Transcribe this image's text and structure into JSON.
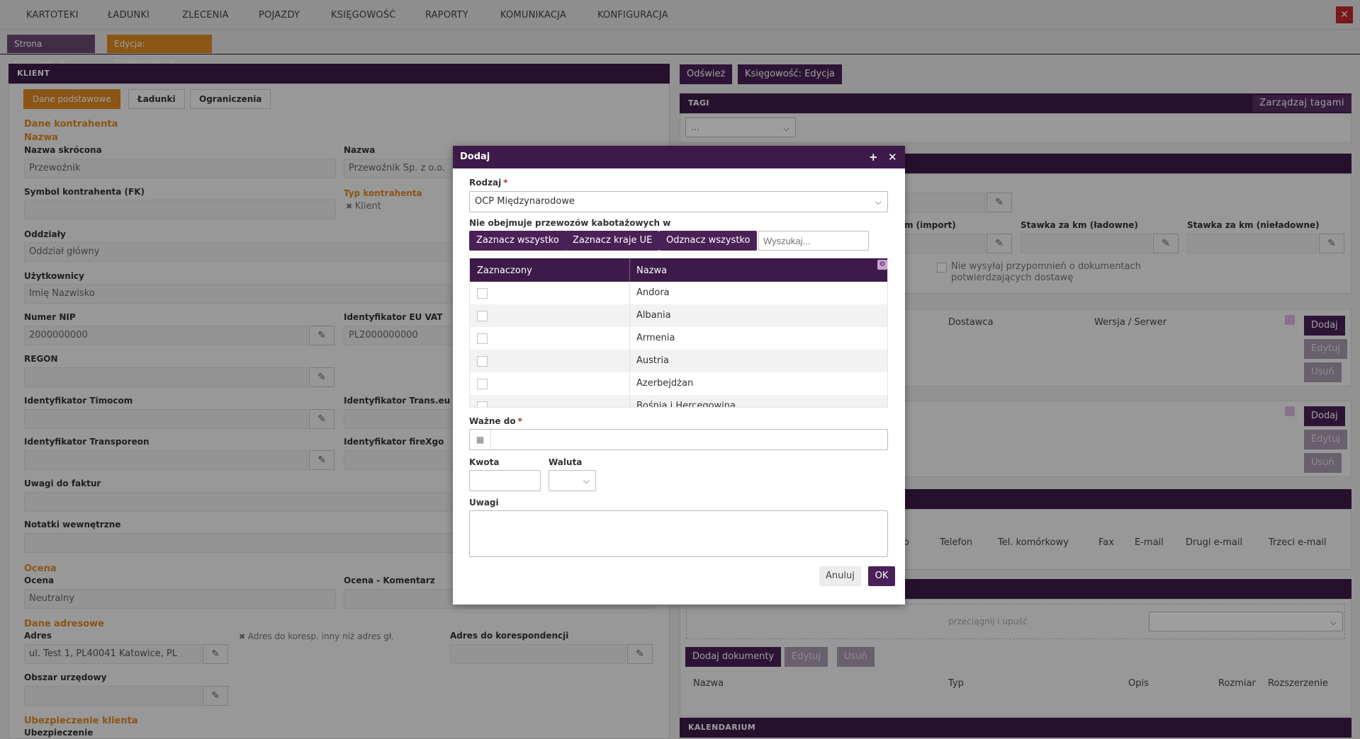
{
  "menu": [
    "KARTOTEKI",
    "ŁADUNKI",
    "ZLECENIA",
    "POJAZDY",
    "KSIĘGOWOŚĆ",
    "RAPORTY",
    "KOMUNIKACJA",
    "KONFIGURACJA"
  ],
  "tabs": [
    {
      "label": "Strona startowa",
      "color": "#6a4a75"
    },
    {
      "label": "Edycja: Przewoźnik",
      "color": "#e08a22"
    }
  ],
  "client_panel": {
    "header": "KLIENT",
    "subtabs": [
      "Dane podstawowe",
      "Ładunki",
      "Ograniczenia"
    ],
    "section_dane_kontrahenta": "Dane kontrahenta",
    "section_nazwa": "Nazwa",
    "nazwa_skrocona_label": "Nazwa skrócona",
    "nazwa_skrocona_value": "Przewoźnik",
    "nazwa_label": "Nazwa",
    "nazwa_value": "Przewoźnik Sp. z o.o.",
    "symbol_label": "Symbol kontrahenta (FK)",
    "typ_label": "Typ kontrahenta",
    "typ_value": "Klient",
    "oddzialy_label": "Oddziały",
    "oddzialy_value": "Oddział główny",
    "uzytkownicy_label": "Użytkownicy",
    "uzytkownicy_value": "Imię Nazwisko",
    "nip_label": "Numer NIP",
    "nip_value": "2000000000",
    "euvat_label": "Identyfikator EU VAT",
    "euvat_value": "PL2000000000",
    "regon_label": "REGON",
    "timocom_label": "Identyfikator Timocom",
    "transeu_label": "Identyfikator Trans.eu",
    "transporeon_label": "Identyfikator Transporeon",
    "firexgo_label": "Identyfikator fireXgo",
    "uwagi_faktur_label": "Uwagi do faktur",
    "notatki_label": "Notatki wewnętrzne",
    "section_ocena": "Ocena",
    "ocena_label": "Ocena",
    "ocena_value": "Neutralny",
    "ocena_komentarz_label": "Ocena - Komentarz",
    "section_dane_adresowe": "Dane adresowe",
    "adres_label": "Adres",
    "adres_value": "ul. Test 1, PL40041 Katowice, PL",
    "adres_koresp_checkbox": "Adres do koresp. inny niż adres gł.",
    "adres_koresp_label": "Adres do korespondencji",
    "obszar_label": "Obszar urzędowy",
    "section_ubezpieczenie": "Ubezpieczenie klienta",
    "ubezpieczenie_label": "Ubezpieczenie"
  },
  "right_panel": {
    "odswiez": "Odśwież",
    "ksiegowosc_edycja": "Księgowość: Edycja",
    "tagi_header": "TAGI",
    "zarzadzaj_tagami": "Zarządzaj tagami",
    "tag_select": "...",
    "km_import": "m (import)",
    "stawka_ladowne": "Stawka za km (ładowne)",
    "stawka_nieladowne": "Stawka za km (nieładowne)",
    "przypomnienia": "Nie wysyłaj przypomnień o dokumentach potwierdzających dostawę",
    "dostawca": "Dostawca",
    "wersja_serwer": "Wersja / Serwer",
    "dodaj": "Dodaj",
    "edytuj": "Edytuj",
    "usun": "Usuń",
    "contact_cols": [
      "o",
      "Telefon",
      "Tel. komórkowy",
      "Fax",
      "E-mail",
      "Drugi e-mail",
      "Trzeci e-mail"
    ],
    "drag_drop": "przeciągnij i upuść",
    "dodaj_dokumenty": "Dodaj dokumenty",
    "doc_cols": [
      "Nazwa",
      "Typ",
      "Opis",
      "Rozmiar",
      "Rozszerzenie"
    ],
    "kalendarium_header": "KALENDARIUM"
  },
  "dialog": {
    "title": "Dodaj",
    "rodzaj_label": "Rodzaj",
    "rodzaj_value": "OCP Międzynarodowe",
    "kabotaz_label": "Nie obejmuje przewozów kabotażowych w",
    "btn_select_all": "Zaznacz wszystko",
    "btn_select_eu": "Zaznacz kraje UE",
    "btn_deselect_all": "Odznacz wszystko",
    "search_placeholder": "Wyszukaj...",
    "grid_col_checked": "Zaznaczony",
    "grid_col_name": "Nazwa",
    "countries": [
      "Andora",
      "Albania",
      "Armenia",
      "Austria",
      "Azerbejdżan",
      "Bośnia i Hercegowina"
    ],
    "wazne_do_label": "Ważne do",
    "kwota_label": "Kwota",
    "waluta_label": "Waluta",
    "uwagi_label": "Uwagi",
    "cancel": "Anuluj",
    "ok": "OK"
  }
}
